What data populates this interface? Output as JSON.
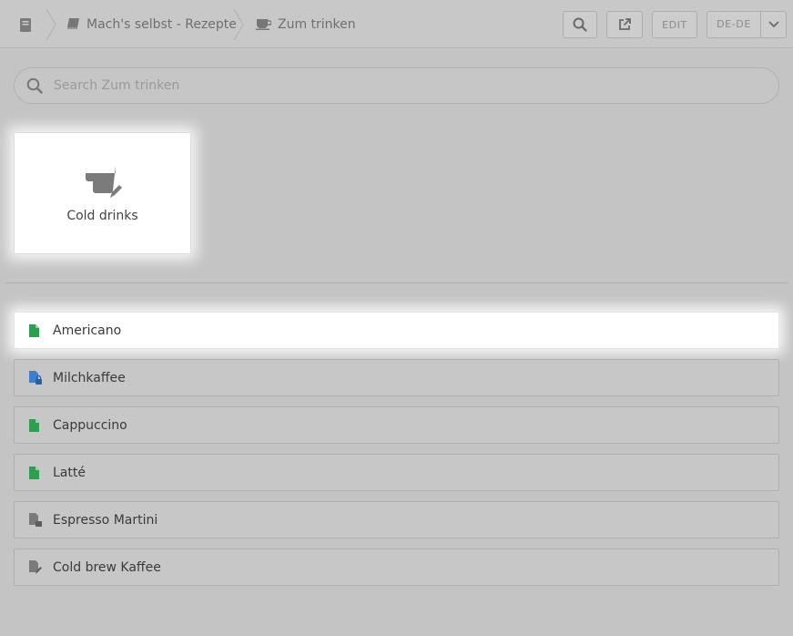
{
  "breadcrumb": {
    "items": [
      {
        "label": "Mach's selbst - Rezepte",
        "icon": "book-icon"
      },
      {
        "label": "Zum trinken",
        "icon": "coffee-cup-icon"
      }
    ]
  },
  "toolbar": {
    "edit_label": "EDIT",
    "language_label": "DE-DE"
  },
  "search": {
    "placeholder": "Search Zum trinken"
  },
  "categories": [
    {
      "label": "Cold drinks",
      "icon": "cup-edit-icon"
    }
  ],
  "documents": [
    {
      "label": "Americano",
      "icon": "document-icon",
      "status_color": "#2e9e4f"
    },
    {
      "label": "Milchkaffee",
      "icon": "document-lock-icon",
      "status_color": "#3b7fd4"
    },
    {
      "label": "Cappuccino",
      "icon": "document-icon",
      "status_color": "#2e9e4f"
    },
    {
      "label": "Latté",
      "icon": "document-icon",
      "status_color": "#2e9e4f"
    },
    {
      "label": "Espresso Martini",
      "icon": "document-draft-icon",
      "status_color": "#7a7a7a"
    },
    {
      "label": "Cold brew Kaffee",
      "icon": "document-edit-icon",
      "status_color": "#7a7a7a"
    }
  ]
}
